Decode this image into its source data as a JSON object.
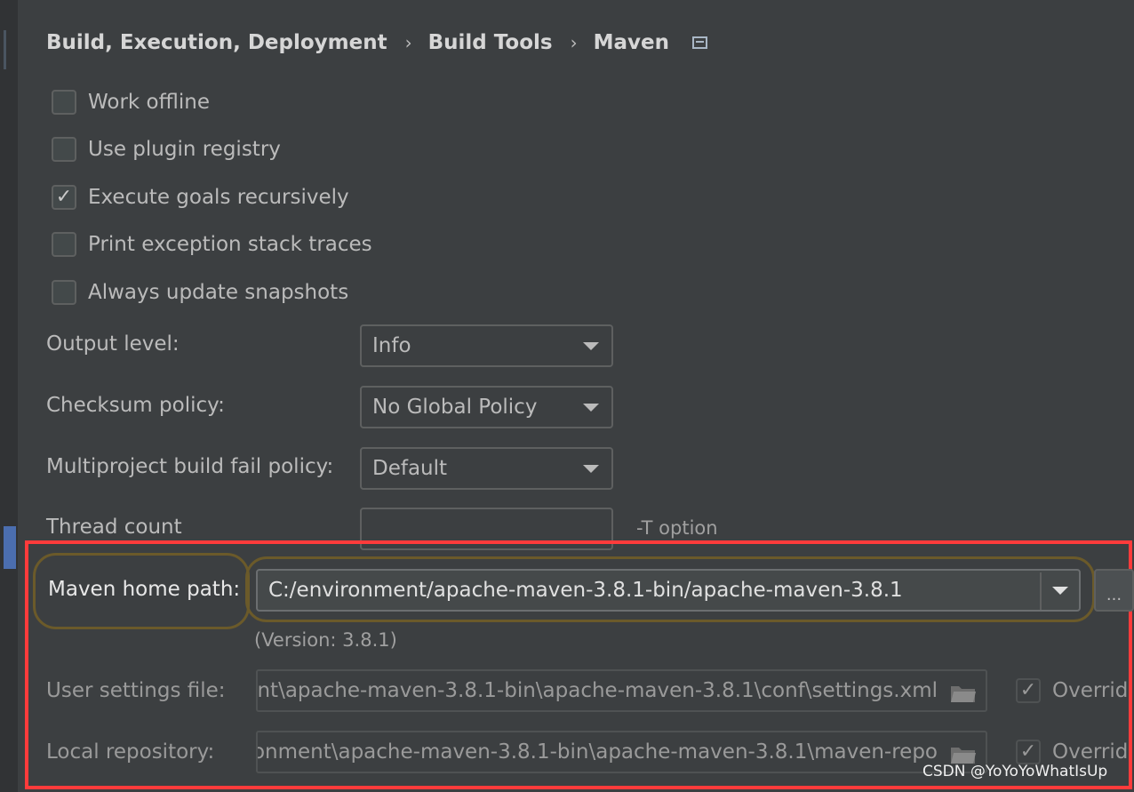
{
  "breadcrumb": {
    "items": [
      "Build, Execution, Deployment",
      "Build Tools",
      "Maven"
    ],
    "separator": "›",
    "icon": "pin-window-icon"
  },
  "options": [
    {
      "label": "Work offline",
      "checked": false
    },
    {
      "label": "Use plugin registry",
      "checked": false
    },
    {
      "label": "Execute goals recursively",
      "checked": true
    },
    {
      "label": "Print exception stack traces",
      "checked": false
    },
    {
      "label": "Always update snapshots",
      "checked": false
    }
  ],
  "check_mark": "✓",
  "output_level": {
    "label": "Output level:",
    "value": "Info"
  },
  "checksum_policy": {
    "label": "Checksum policy:",
    "value": "No Global Policy"
  },
  "fail_policy": {
    "label": "Multiproject build fail policy:",
    "value": "Default"
  },
  "thread_count": {
    "label": "Thread count",
    "value": "",
    "hint": "-T option"
  },
  "maven_home": {
    "label": "Maven home path:",
    "value": "C:/environment/apache-maven-3.8.1-bin/apache-maven-3.8.1",
    "browse_label": "...",
    "version": "(Version: 3.8.1)"
  },
  "user_settings": {
    "label": "User settings file:",
    "value": "nt\\apache-maven-3.8.1-bin\\apache-maven-3.8.1\\conf\\settings.xml",
    "override_label": "Overrid",
    "override_checked": true
  },
  "local_repo": {
    "label": "Local repository:",
    "value": "onment\\apache-maven-3.8.1-bin\\apache-maven-3.8.1\\maven-repo",
    "override_label": "Overrid",
    "override_checked": true
  },
  "watermark": "CSDN @YoYoYoWhatIsUp",
  "colors": {
    "background": "#3c3f41",
    "highlight": "#ff3b3b",
    "accent": "#4b6eaf"
  }
}
